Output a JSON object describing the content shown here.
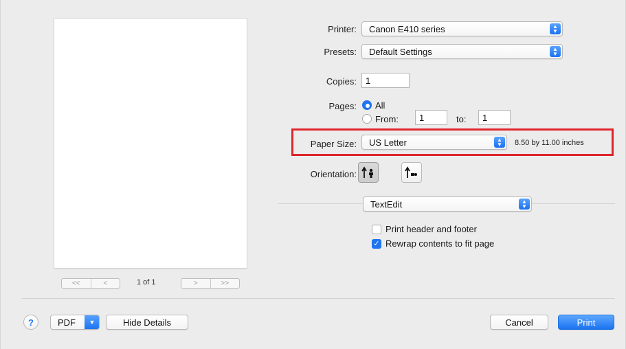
{
  "preview": {
    "nav_first": "<<",
    "nav_prev": "<",
    "nav_next": ">",
    "nav_last": ">>",
    "page_count": "1 of 1"
  },
  "printer": {
    "label": "Printer:",
    "value": "Canon E410 series"
  },
  "presets": {
    "label": "Presets:",
    "value": "Default Settings"
  },
  "copies": {
    "label": "Copies:",
    "value": "1"
  },
  "pages": {
    "label": "Pages:",
    "all_label": "All",
    "from_label": "From:",
    "from_value": "1",
    "to_label": "to:",
    "to_value": "1",
    "selected": "All"
  },
  "paper_size": {
    "label": "Paper Size:",
    "value": "US Letter",
    "dimensions": "8.50 by 11.00 inches",
    "highlight_color": "#e0242c"
  },
  "orientation": {
    "label": "Orientation:",
    "selected": "portrait"
  },
  "app_section": {
    "value": "TextEdit"
  },
  "options": {
    "print_header_footer": {
      "label": "Print header and footer",
      "checked": false
    },
    "rewrap_contents": {
      "label": "Rewrap contents to fit page",
      "checked": true
    }
  },
  "footer": {
    "help": "?",
    "pdf": "PDF",
    "hide_details": "Hide Details",
    "cancel": "Cancel",
    "print": "Print"
  },
  "colors": {
    "accent": "#1f74f1",
    "background": "#ececec"
  }
}
